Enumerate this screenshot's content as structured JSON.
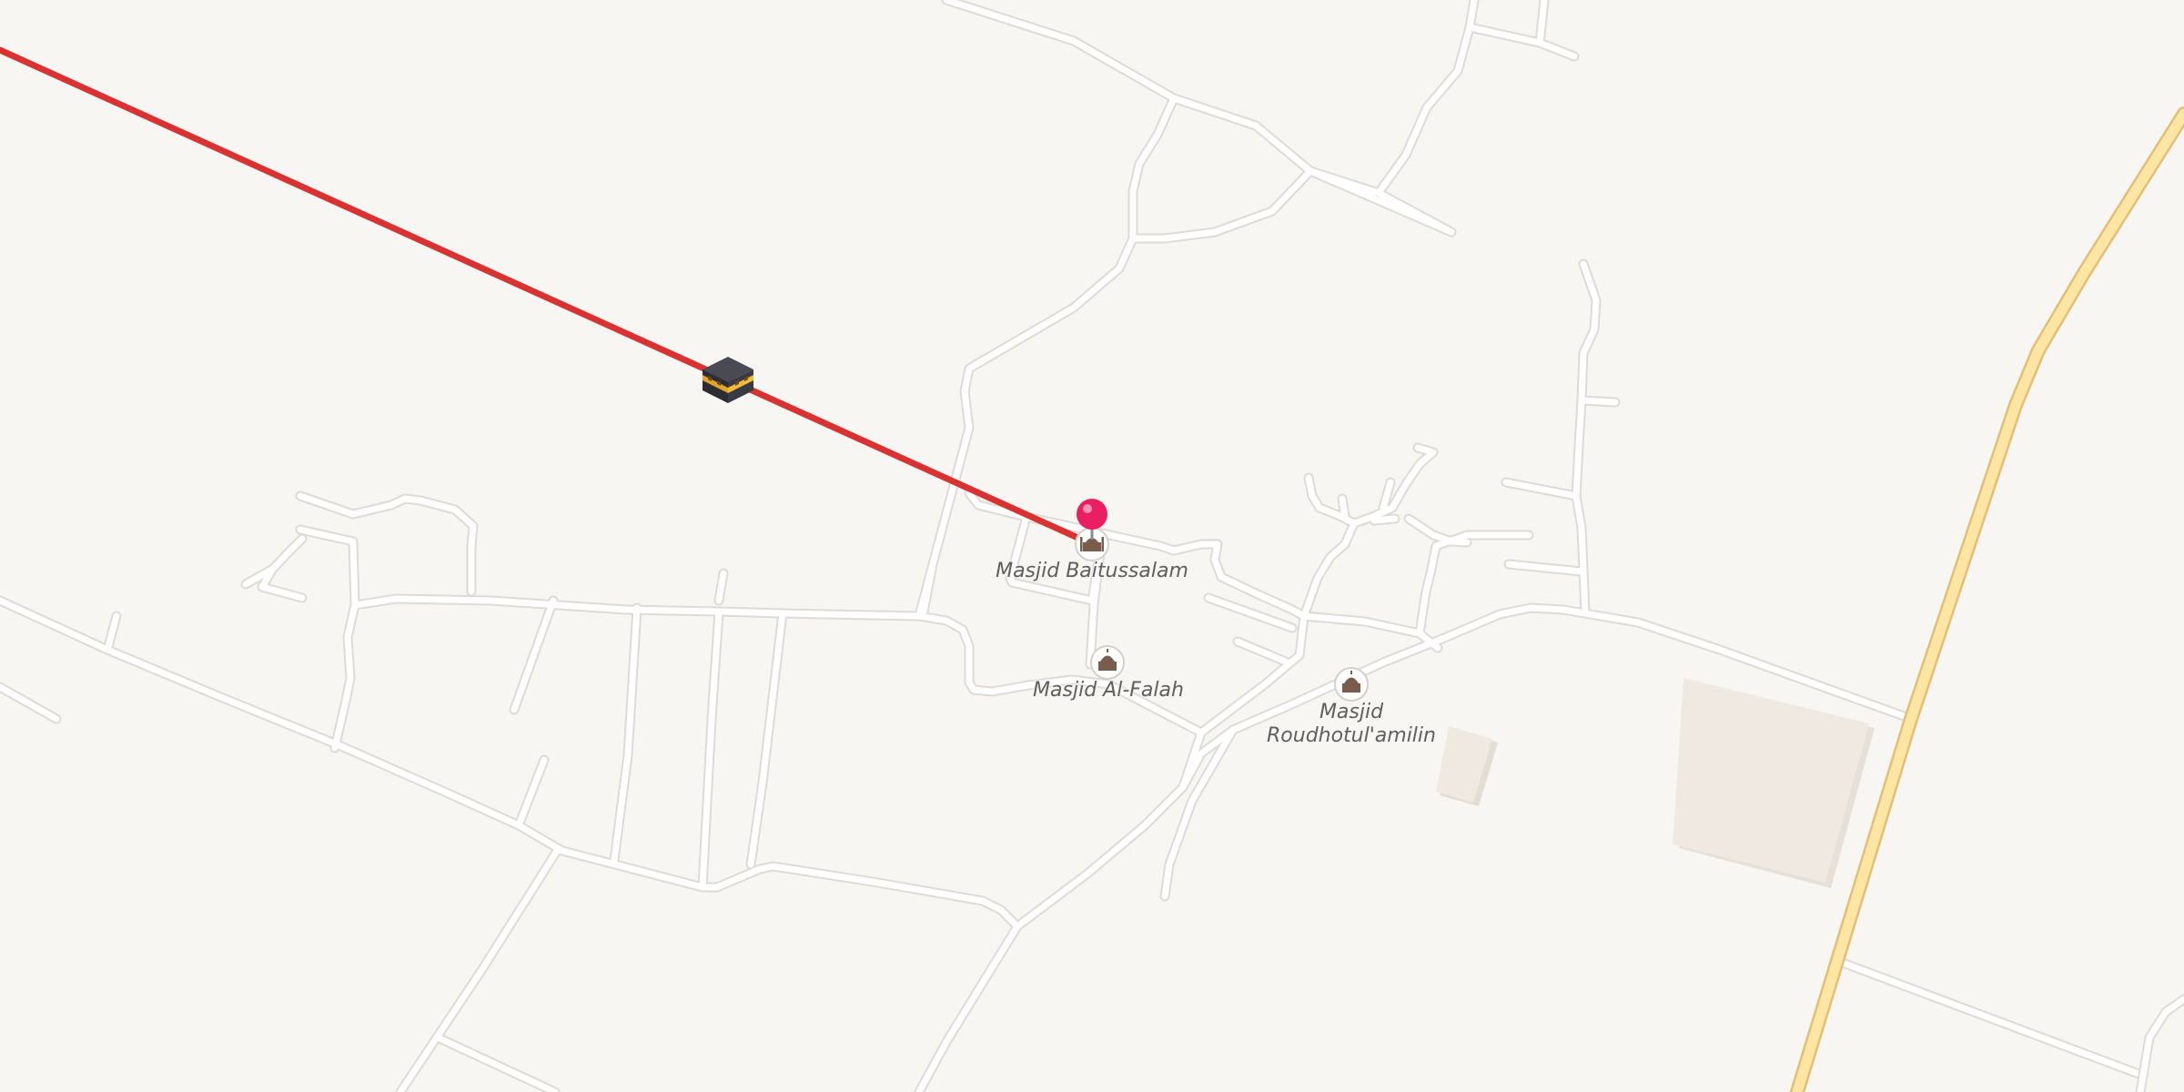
{
  "map": {
    "colors": {
      "background": "#f8f6f3",
      "road_fill": "#ffffff",
      "road_casing": "#dedbd6",
      "highway_fill": "#fde6a4",
      "highway_casing": "#e9c87f",
      "building": "#efe9e2",
      "qibla_line": "#d93232",
      "pin": "#e91e63",
      "poi_icon": "#7a5c4d"
    },
    "poi_icon_name": "mosque-icon",
    "kaaba_icon_name": "kaaba-icon",
    "pin_icon_name": "location-pin-icon",
    "pois": [
      {
        "label": "Masjid Baitussalam"
      },
      {
        "label": "Masjid Al-Falah"
      },
      {
        "label": "Masjid\nRoudhotul'amilin"
      }
    ]
  }
}
